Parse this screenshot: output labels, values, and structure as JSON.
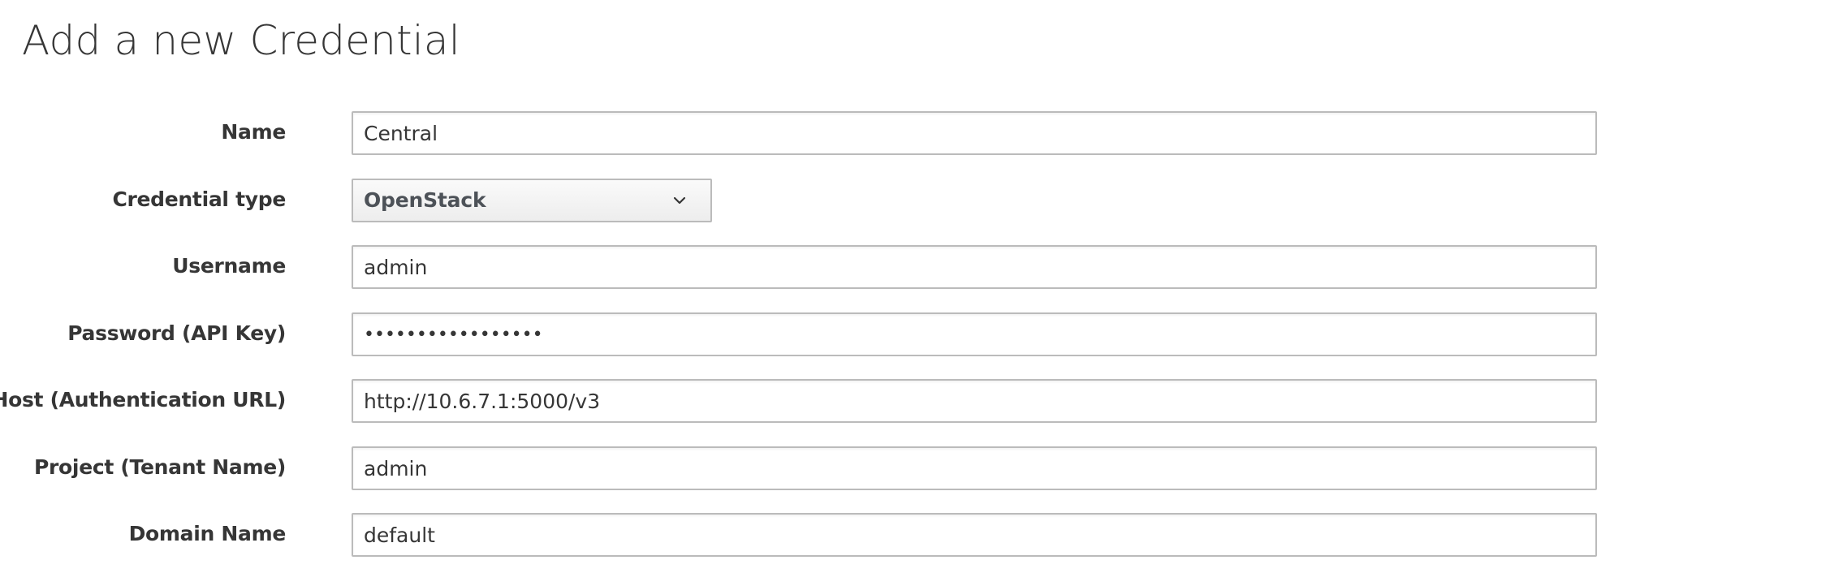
{
  "page": {
    "title": "Add a new Credential"
  },
  "form": {
    "name": {
      "label": "Name",
      "value": "Central"
    },
    "credential_type": {
      "label": "Credential type",
      "value": "OpenStack"
    },
    "username": {
      "label": "Username",
      "value": "admin"
    },
    "password": {
      "label": "Password (API Key)",
      "value": "•••••••••••••••••"
    },
    "host": {
      "label": "Host (Authentication URL)",
      "value": "http://10.6.7.1:5000/v3"
    },
    "project": {
      "label": "Project (Tenant Name)",
      "value": "admin"
    },
    "domain": {
      "label": "Domain Name",
      "value": "default"
    }
  },
  "icons": {
    "select_arrow": "chevron-down-icon"
  },
  "colors": {
    "text": "#363636",
    "border": "#bbbbbb",
    "select_bg": "#f5f5f5",
    "background": "#ffffff"
  }
}
